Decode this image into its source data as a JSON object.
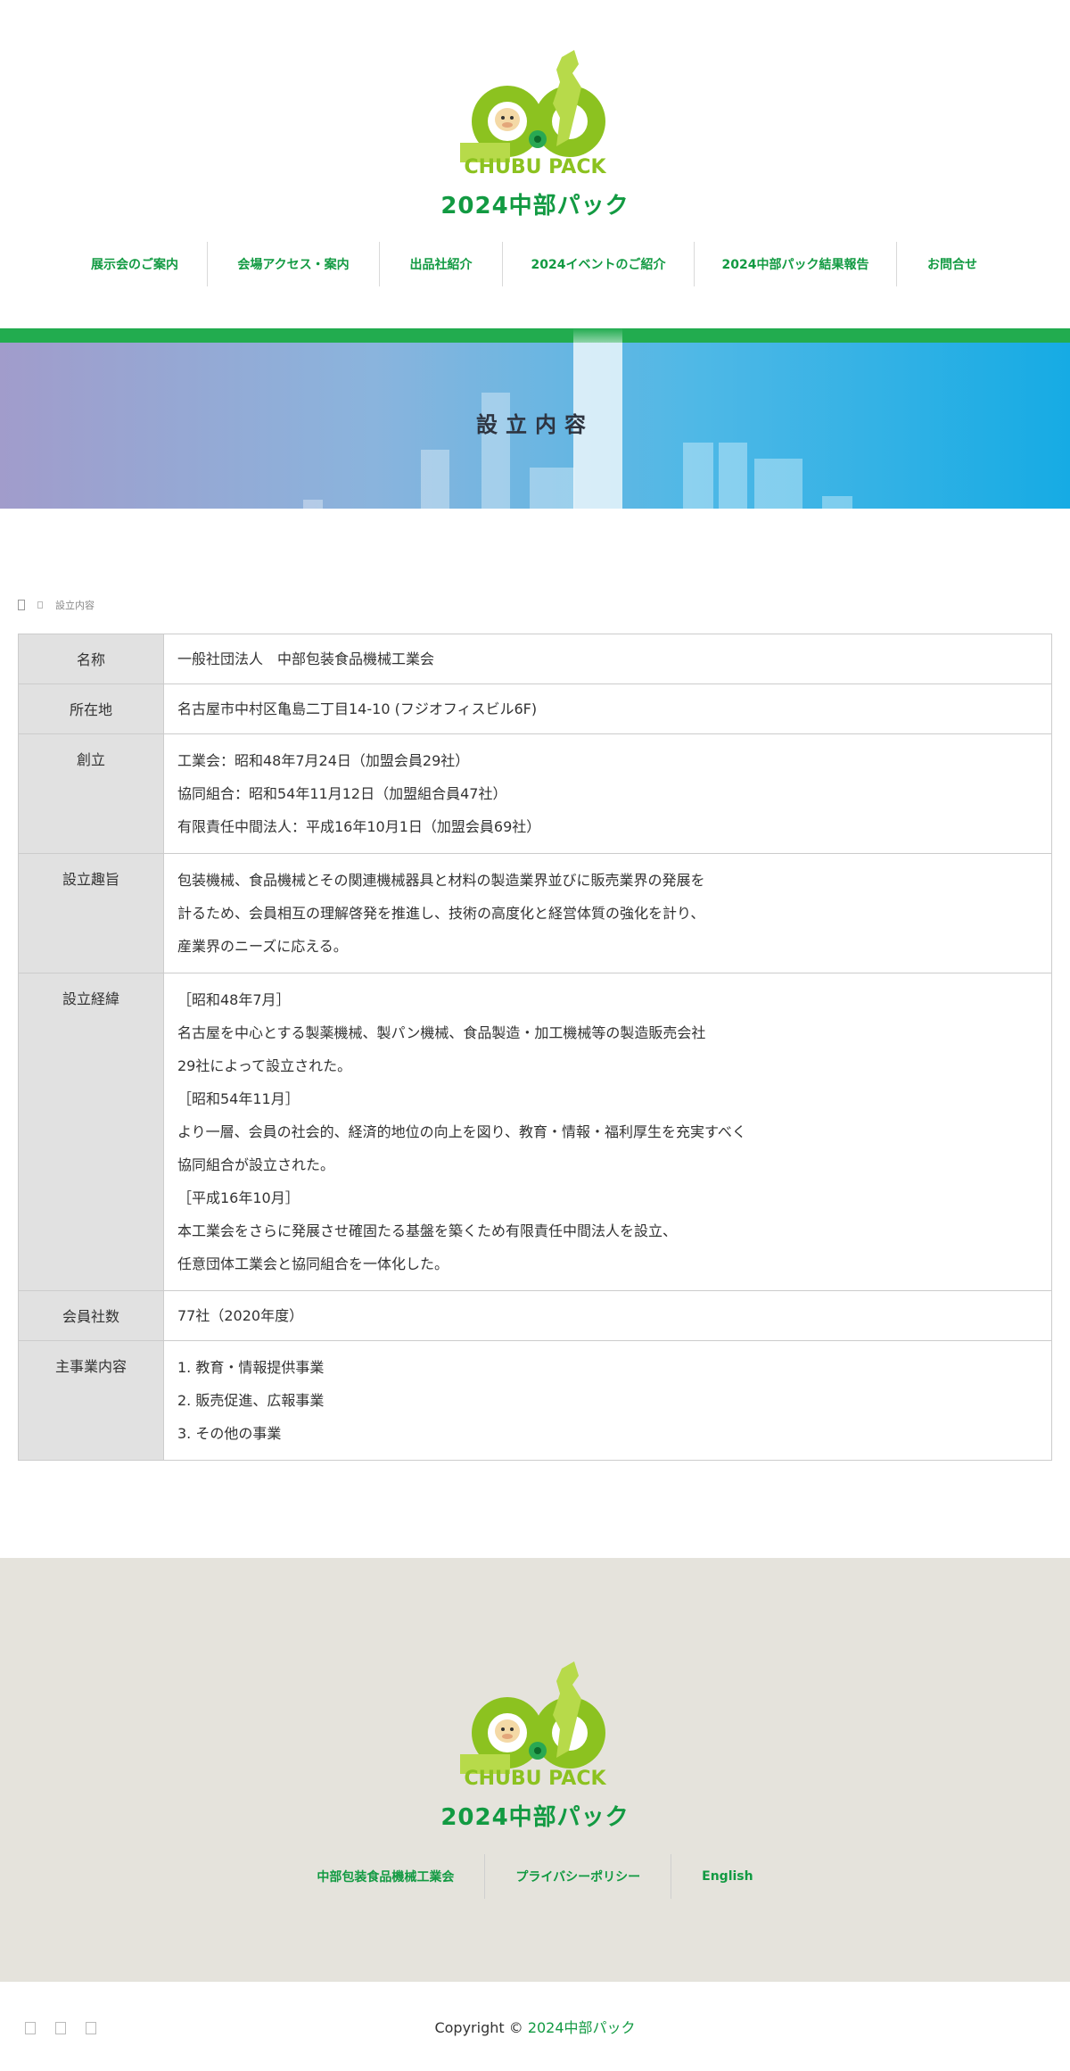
{
  "header": {
    "site_name": "2024中部パック",
    "logo_text": "CHUBU PACK",
    "nav": [
      {
        "label": "展示会のご案内"
      },
      {
        "label": "会場アクセス・案内"
      },
      {
        "label": "出品社紹介"
      },
      {
        "label": "2024イベントのご紹介"
      },
      {
        "label": "2024中部パック結果報告"
      },
      {
        "label": "お問合せ"
      }
    ]
  },
  "hero": {
    "title": "設立内容"
  },
  "breadcrumb": {
    "home_icon": "home-icon",
    "separator_icon": "chevron-right-icon",
    "current": "設立内容"
  },
  "table": {
    "rows": [
      {
        "label": "名称",
        "lines": [
          "一般社団法人　中部包装食品機械工業会"
        ]
      },
      {
        "label": "所在地",
        "lines": [
          "名古屋市中村区亀島二丁目14-10 (フジオフィスビル6F)"
        ]
      },
      {
        "label": "創立",
        "lines": [
          "工業会：昭和48年7月24日（加盟会員29社）",
          "協同組合：昭和54年11月12日（加盟組合員47社）",
          "有限責任中間法人：平成16年10月1日（加盟会員69社）"
        ]
      },
      {
        "label": "設立趣旨",
        "lines": [
          "包装機械、食品機械とその関連機械器具と材料の製造業界並びに販売業界の発展を",
          "計るため、会員相互の理解啓発を推進し、技術の高度化と経営体質の強化を計り、",
          "産業界のニーズに応える。"
        ]
      },
      {
        "label": "設立経緯",
        "lines": [
          "［昭和48年7月］",
          "名古屋を中心とする製薬機械、製パン機械、食品製造・加工機械等の製造販売会社",
          "29社によって設立された。",
          "［昭和54年11月］",
          "より一層、会員の社会的、経済的地位の向上を図り、教育・情報・福利厚生を充実すべく",
          "協同組合が設立された。",
          "［平成16年10月］",
          "本工業会をさらに発展させ確固たる基盤を築くため有限責任中間法人を設立、",
          "任意団体工業会と協同組合を一体化した。"
        ]
      },
      {
        "label": "会員社数",
        "lines": [
          "77社（2020年度）"
        ]
      },
      {
        "label": "主事業内容",
        "lines": [
          "1. 教育・情報提供事業",
          "2. 販売促進、広報事業",
          "3. その他の事業"
        ]
      }
    ]
  },
  "footer": {
    "site_name": "2024中部パック",
    "logo_text": "CHUBU PACK",
    "nav": [
      {
        "label": "中部包装食品機械工業会"
      },
      {
        "label": "プライバシーポリシー"
      },
      {
        "label": "English"
      }
    ],
    "copyright_prefix": "Copyright ©",
    "copyright_brand": "2024中部パック",
    "social_icons": [
      "social-icon-1",
      "social-icon-2",
      "social-icon-3"
    ]
  },
  "colors": {
    "brand_green": "#129a42",
    "bar_green": "#22ac4f",
    "footer_bg": "#e5e3dc",
    "th_bg": "#e1e1e1"
  }
}
